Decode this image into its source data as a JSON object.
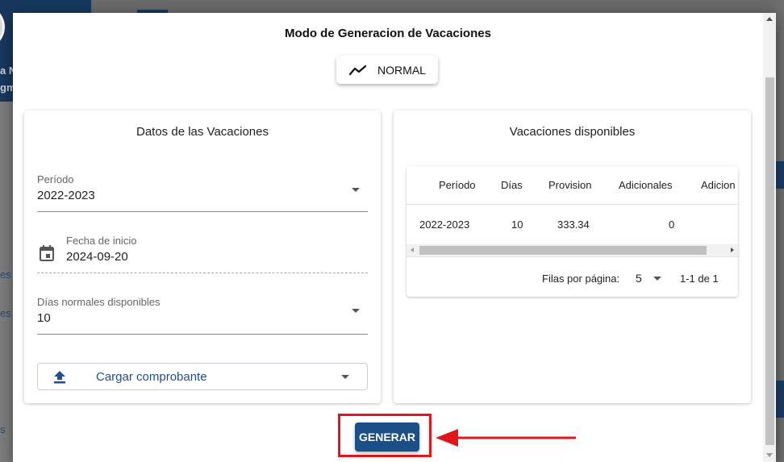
{
  "background": {
    "sidebar_fragments": [
      "a N",
      "gm"
    ],
    "nav_fragments": [
      "es",
      "es",
      "s"
    ]
  },
  "dialog": {
    "title": "Modo de Generacion de Vacaciones",
    "mode_button": {
      "label": "NORMAL",
      "icon": "trend-line-icon"
    }
  },
  "left_card": {
    "title": "Datos de las Vacaciones",
    "periodo": {
      "label": "Período",
      "value": "2022-2023"
    },
    "fecha_inicio": {
      "label": "Fecha de inicio",
      "value": "2024-09-20",
      "icon": "calendar-icon"
    },
    "dias_disponibles": {
      "label": "Días normales disponibles",
      "value": "10"
    },
    "upload": {
      "label": "Cargar comprobante",
      "icon": "upload-icon"
    }
  },
  "right_card": {
    "title": "Vacaciones disponibles",
    "table": {
      "columns": [
        "Período",
        "Días",
        "Provision",
        "Adicionales",
        "Adicion"
      ],
      "rows": [
        {
          "periodo": "2022-2023",
          "dias": "10",
          "provision": "333.34",
          "adicionales": "0"
        }
      ]
    },
    "pagination": {
      "rows_per_page_label": "Filas por página:",
      "rows_per_page_value": "5",
      "range": "1-1 de 1"
    }
  },
  "actions": {
    "generate_label": "GENERAR"
  },
  "colors": {
    "primary": "#1b4f88",
    "annotation": "#e0161b",
    "link": "#1d4f91"
  }
}
